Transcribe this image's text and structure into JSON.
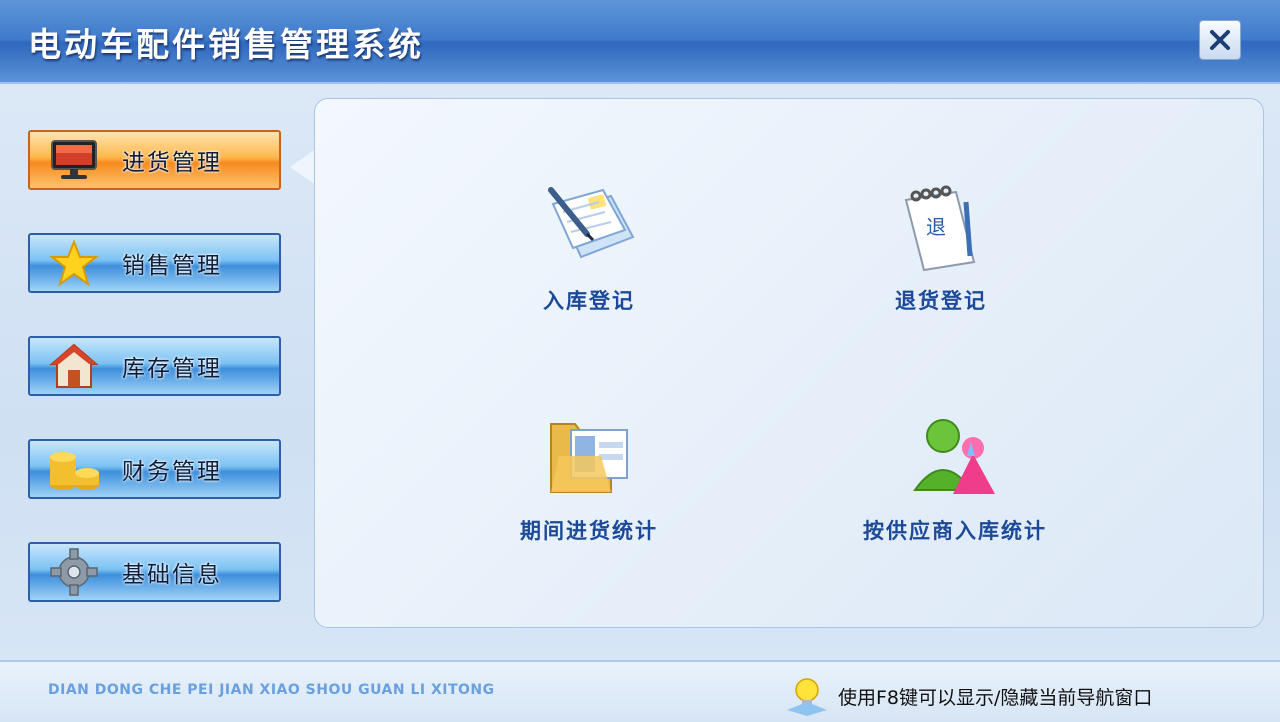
{
  "window": {
    "title": "电动车配件销售管理系统",
    "close_icon": "close-x-icon"
  },
  "sidebar": {
    "items": [
      {
        "label": "进货管理",
        "icon": "monitor-icon",
        "active": true
      },
      {
        "label": "销售管理",
        "icon": "star-icon",
        "active": false
      },
      {
        "label": "库存管理",
        "icon": "house-icon",
        "active": false
      },
      {
        "label": "财务管理",
        "icon": "coins-icon",
        "active": false
      },
      {
        "label": "基础信息",
        "icon": "gear-icon",
        "active": false
      }
    ]
  },
  "main": {
    "functions": [
      {
        "label": "入库登记",
        "icon": "document-pen-icon"
      },
      {
        "label": "退货登记",
        "icon": "return-calendar-icon"
      },
      {
        "label": "期间进货统计",
        "icon": "folder-chart-icon"
      },
      {
        "label": "按供应商入库统计",
        "icon": "supplier-people-icon"
      }
    ]
  },
  "footer": {
    "pinyin": "DIAN DONG CHE PEI JIAN XIAO SHOU GUAN LI XITONG",
    "hint": "使用F8键可以显示/隐藏当前导航窗口",
    "hint_icon": "lightbulb-icon"
  },
  "colors": {
    "titlebar": "#3f7acb",
    "nav_active": "#f58a1f",
    "nav_inactive": "#3d8fdc",
    "function_label": "#1d4a98"
  }
}
